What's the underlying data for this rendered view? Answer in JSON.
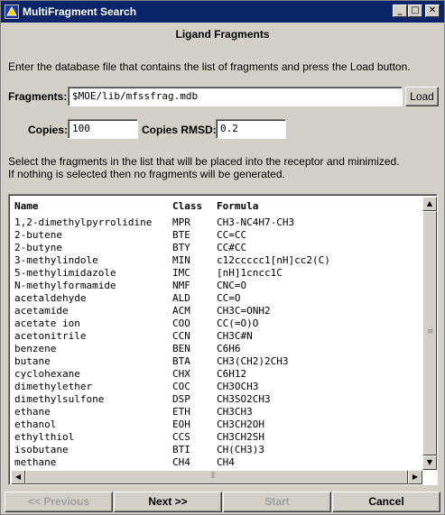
{
  "window": {
    "title": "MultiFragment Search",
    "controls": {
      "minimize": "_",
      "maximize": "□",
      "close": "✕"
    }
  },
  "heading": "Ligand Fragments",
  "instructions": "Enter the database file that contains the list of fragments and press the Load button.",
  "fragments": {
    "label": "Fragments:",
    "value": "$MOE/lib/mfssfrag.mdb",
    "load_label": "Load"
  },
  "copies": {
    "label": "Copies:",
    "value": "100",
    "rmsd_label": "Copies RMSD:",
    "rmsd_value": "0.2"
  },
  "select_note": {
    "line1": "Select the fragments in the list that will be placed into the receptor and minimized.",
    "line2": "If nothing is selected then no fragments will be generated."
  },
  "table": {
    "columns": [
      "Name",
      "Class",
      "Formula"
    ],
    "rows": [
      [
        "1,2-dimethylpyrrolidine",
        "MPR",
        "CH3-NC4H7-CH3"
      ],
      [
        "2-butene",
        "BTE",
        "CC=CC"
      ],
      [
        "2-butyne",
        "BTY",
        "CC#CC"
      ],
      [
        "3-methylindole",
        "MIN",
        "c12ccccc1[nH]cc2(C)"
      ],
      [
        "5-methylimidazole",
        "IMC",
        "[nH]1cncc1C"
      ],
      [
        "N-methylformamide",
        "NMF",
        "CNC=O"
      ],
      [
        "acetaldehyde",
        "ALD",
        "CC=O"
      ],
      [
        "acetamide",
        "ACM",
        "CH3C=ONH2"
      ],
      [
        "acetate ion",
        "COO",
        "CC(=O)O"
      ],
      [
        "acetonitrile",
        "CCN",
        "CH3C#N"
      ],
      [
        "benzene",
        "BEN",
        "C6H6"
      ],
      [
        "butane",
        "BTA",
        "CH3(CH2)2CH3"
      ],
      [
        "cyclohexane",
        "CHX",
        "C6H12"
      ],
      [
        "dimethylether",
        "COC",
        "CH3OCH3"
      ],
      [
        "dimethylsulfone",
        "DSP",
        "CH3SO2CH3"
      ],
      [
        "ethane",
        "ETH",
        "CH3CH3"
      ],
      [
        "ethanol",
        "EOH",
        "CH3CH2OH"
      ],
      [
        "ethylthiol",
        "CCS",
        "CH3CH2SH"
      ],
      [
        "isobutane",
        "BTI",
        "CH(CH3)3"
      ],
      [
        "methane",
        "CH4",
        "CH4"
      ]
    ]
  },
  "scrollbars": {
    "up": "▲",
    "down": "▼",
    "left": "◀",
    "right": "▶",
    "grip_v": "≡",
    "grip_h": "⦀"
  },
  "buttons": {
    "previous": "<<   Previous",
    "next": "Next   >>",
    "start": "Start",
    "cancel": "Cancel"
  }
}
